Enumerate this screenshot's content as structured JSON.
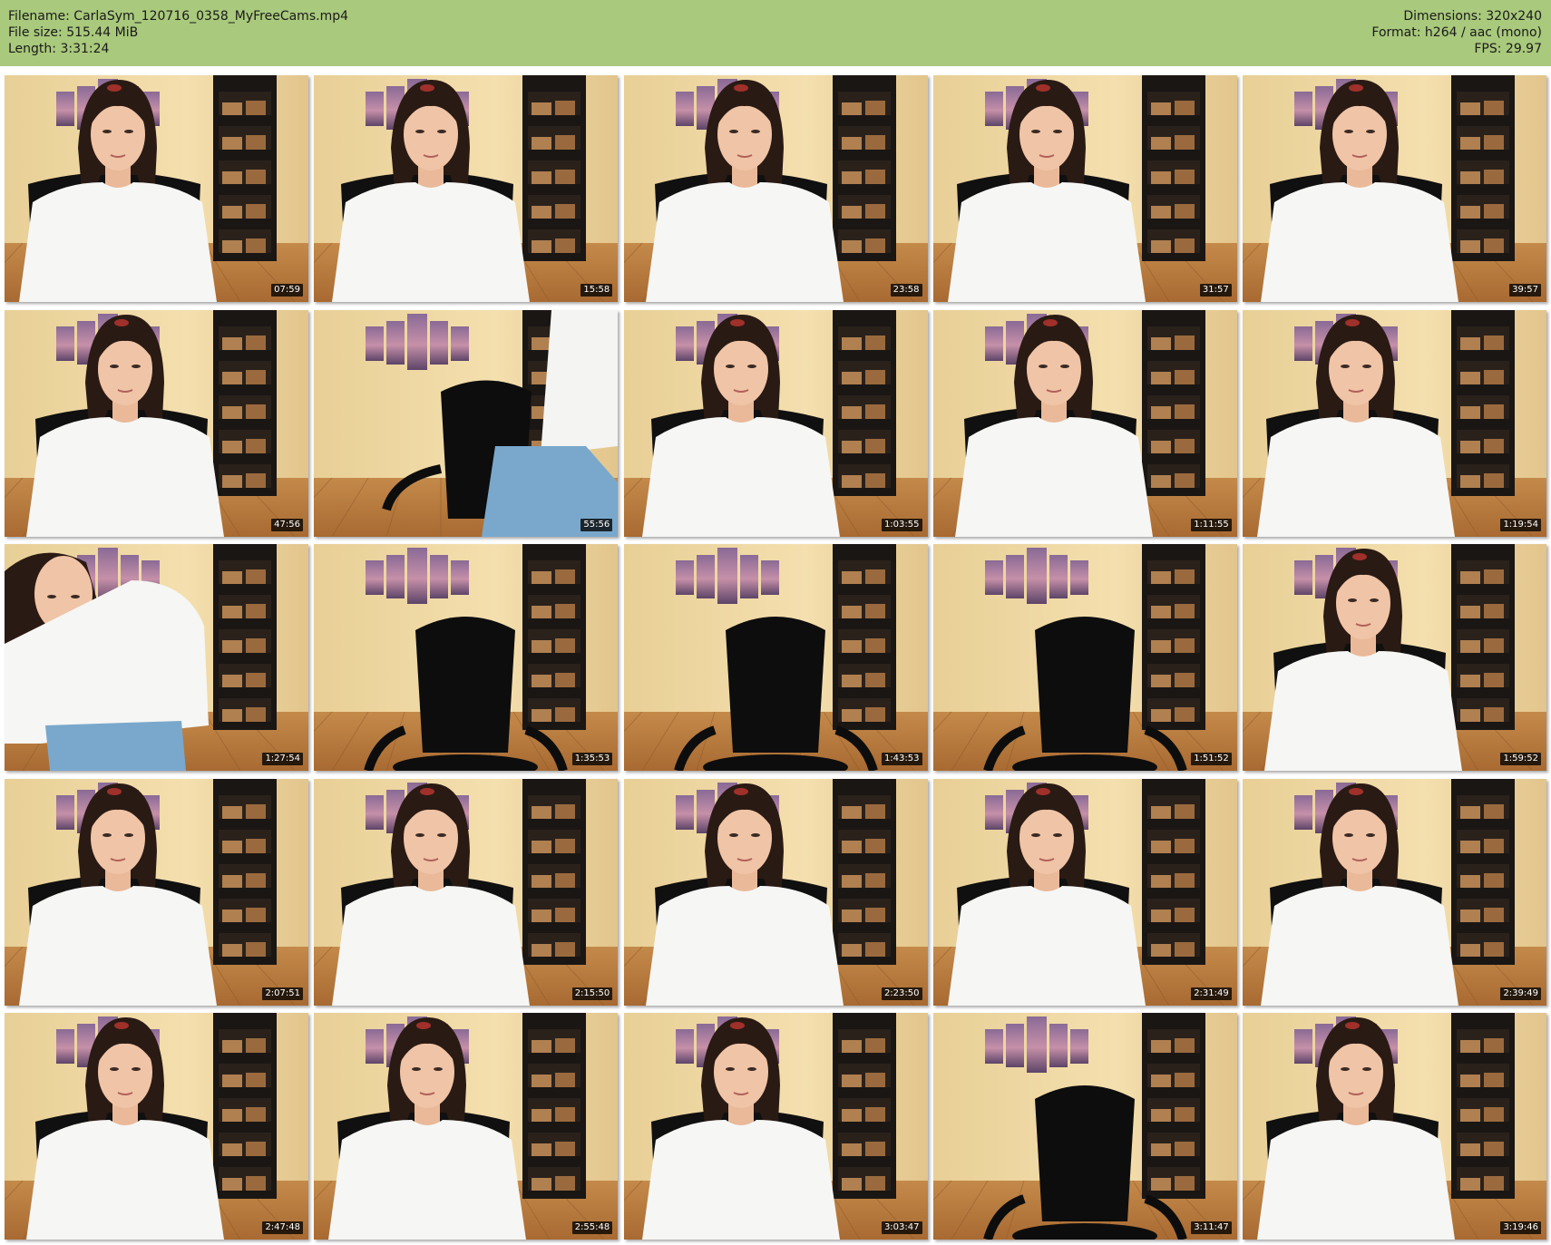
{
  "header": {
    "filename": "Filename: CarlaSym_120716_0358_MyFreeCams.mp4",
    "filesize": "File size: 515.44 MiB",
    "length": "Length: 3:31:24",
    "dimensions": "Dimensions: 320x240",
    "format": "Format: h264 / aac (mono)",
    "fps": "FPS: 29.97"
  },
  "thumbnails": [
    {
      "timestamp": "07:59",
      "scene": "person"
    },
    {
      "timestamp": "15:58",
      "scene": "person"
    },
    {
      "timestamp": "23:58",
      "scene": "person"
    },
    {
      "timestamp": "31:57",
      "scene": "person"
    },
    {
      "timestamp": "39:57",
      "scene": "person"
    },
    {
      "timestamp": "47:56",
      "scene": "person"
    },
    {
      "timestamp": "55:56",
      "scene": "standing"
    },
    {
      "timestamp": "1:03:55",
      "scene": "person"
    },
    {
      "timestamp": "1:11:55",
      "scene": "person"
    },
    {
      "timestamp": "1:19:54",
      "scene": "person"
    },
    {
      "timestamp": "1:27:54",
      "scene": "leaning"
    },
    {
      "timestamp": "1:35:53",
      "scene": "chair"
    },
    {
      "timestamp": "1:43:53",
      "scene": "chair"
    },
    {
      "timestamp": "1:51:52",
      "scene": "chair"
    },
    {
      "timestamp": "1:59:52",
      "scene": "person"
    },
    {
      "timestamp": "2:07:51",
      "scene": "person"
    },
    {
      "timestamp": "2:15:50",
      "scene": "person"
    },
    {
      "timestamp": "2:23:50",
      "scene": "person"
    },
    {
      "timestamp": "2:31:49",
      "scene": "person"
    },
    {
      "timestamp": "2:39:49",
      "scene": "person"
    },
    {
      "timestamp": "2:47:48",
      "scene": "person"
    },
    {
      "timestamp": "2:55:48",
      "scene": "person"
    },
    {
      "timestamp": "3:03:47",
      "scene": "person"
    },
    {
      "timestamp": "3:11:47",
      "scene": "chair"
    },
    {
      "timestamp": "3:19:46",
      "scene": "person"
    }
  ]
}
